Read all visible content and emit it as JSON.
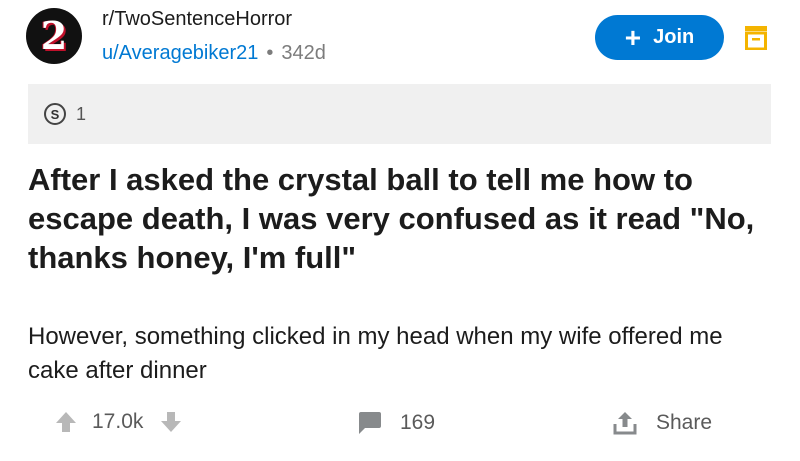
{
  "post": {
    "avatar_text": "2",
    "subreddit": "r/TwoSentenceHorror",
    "author": "u/Averagebiker21",
    "separator": "•",
    "age": "342d",
    "join_label": "Join",
    "award_count": "1",
    "title": "After I asked the crystal ball to tell me how to escape death, I was very confused as it read \"No, thanks honey, I'm full\"",
    "body": "However, something clicked in my head when my wife offered me cake after dinner"
  },
  "actions": {
    "score": "17.0k",
    "comments": "169",
    "share_label": "Share"
  },
  "colors": {
    "accent": "#0079d3",
    "save_icon": "#f4b400",
    "award_bar_bg": "#f0f0f0"
  },
  "icons": {
    "save": "save-icon",
    "upvote": "upvote-icon",
    "downvote": "downvote-icon",
    "comment": "comment-icon",
    "share": "share-icon",
    "award": "award-icon"
  }
}
